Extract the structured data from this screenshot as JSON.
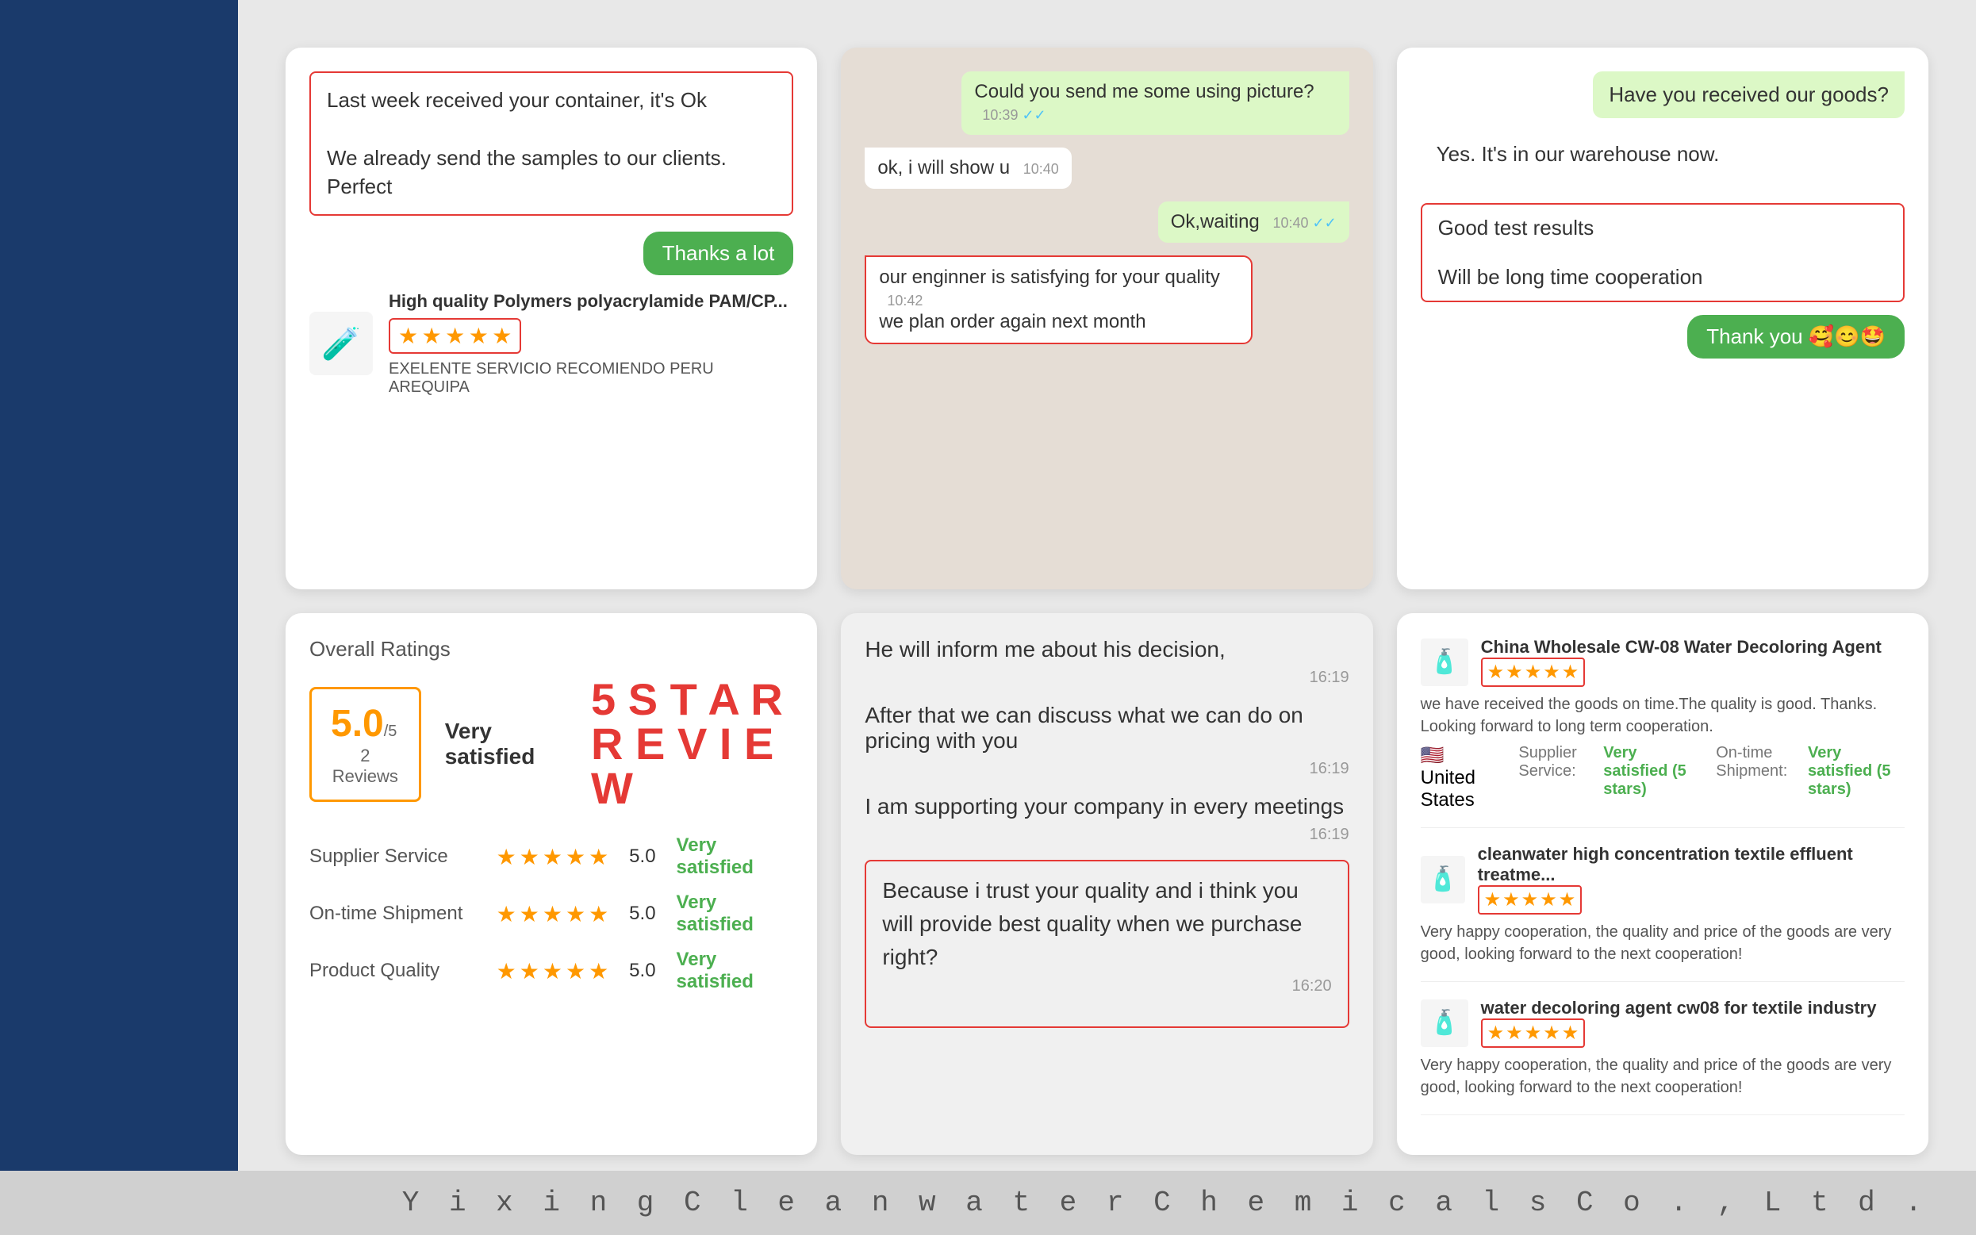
{
  "sidebar": {},
  "card1": {
    "chat_left_line1": "Last week received your container, it's Ok",
    "chat_left_line2": "We already send the samples to our clients. Perfect",
    "chat_green": "Thanks a lot",
    "product_name": "High quality Polymers polyacrylamide PAM/CP...",
    "product_origin": "EXELENTE SERVICIO RECOMIENDO PERU AREQUIPA",
    "product_icon": "🧪"
  },
  "card2": {
    "msg1": "Could you send me some using picture?",
    "msg1_time": "10:39",
    "msg2": "ok, i will show u",
    "msg2_time": "10:40",
    "msg3": "Ok,waiting",
    "msg3_time": "10:40",
    "msg4": "our enginner is satisfying for your quality",
    "msg4_time": "10:42",
    "msg5": "we plan order again next month"
  },
  "card3": {
    "msg1": "Have you received our goods?",
    "msg2_line1": "Yes. It's in our warehouse now.",
    "msg3": "Good test results",
    "msg4": "Will be long time cooperation",
    "msg5": "Thank you 🥰😊🤩"
  },
  "card4": {
    "header": "Overall Ratings",
    "score": "5.0",
    "score_suffix": "/5",
    "reviews": "2 Reviews",
    "satisfied_label": "Very satisfied",
    "five_star": "5STAR\nREVIEW",
    "five_star_line1": "5 S T A R",
    "five_star_line2": "R E V I E W",
    "rows": [
      {
        "label": "Supplier Service",
        "score": "5.0",
        "satisfied": "Very satisfied"
      },
      {
        "label": "On-time Shipment",
        "score": "5.0",
        "satisfied": "Very satisfied"
      },
      {
        "label": "Product Quality",
        "score": "5.0",
        "satisfied": "Very satisfied"
      }
    ]
  },
  "card5": {
    "msg1": "He will inform me about his decision,",
    "msg1_time": "16:19",
    "msg2": "After that we can discuss what we can do on pricing with you",
    "msg2_time": "16:19",
    "msg3": "I am supporting your company in every meetings",
    "msg3_time": "16:19",
    "msg4": "Because i trust your quality and i think you will provide best quality when we purchase right?",
    "msg4_time": "16:20"
  },
  "card6": {
    "reviews": [
      {
        "product": "China Wholesale CW-08 Water Decoloring Agent",
        "icon": "🧴",
        "review_text": "we have received the goods on time.The quality is good. Thanks. Looking forward to long term cooperation.",
        "supplier_service": "Very satisfied (5 stars)",
        "ontime_shipment": "Very satisfied (5 stars)",
        "country": "🇺🇸 United States"
      },
      {
        "product": "cleanwater high concentration textile effluent treatme...",
        "icon": "🧴",
        "review_text": "Very happy cooperation, the quality and price of the goods are very good, looking forward to the next cooperation!",
        "stars": 5
      },
      {
        "product": "water decoloring agent cw08 for textile industry",
        "icon": "🧴",
        "review_text": "Very happy cooperation, the quality and price of the goods are very good, looking forward to the next cooperation!",
        "stars": 5
      }
    ]
  },
  "footer": {
    "company": "Y i x i n g   C l e a n w a t e r   C h e m i c a l s   C o . ,   L t d ."
  }
}
